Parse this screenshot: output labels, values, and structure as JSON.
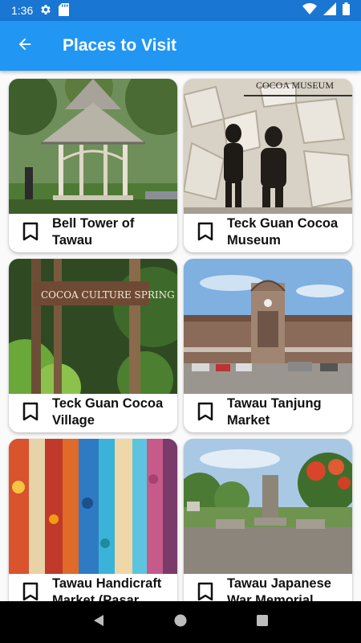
{
  "status_bar": {
    "time": "1:36",
    "icons": [
      "gear-icon",
      "sd-card-icon",
      "wifi-icon",
      "signal-icon",
      "battery-icon"
    ]
  },
  "app_bar": {
    "title": "Places to Visit",
    "back_icon": "arrow-back-icon"
  },
  "places": [
    {
      "title": "Bell Tower of Tawau",
      "bookmark_icon": "bookmark-outline-icon"
    },
    {
      "title": "Teck Guan Cocoa Museum",
      "bookmark_icon": "bookmark-outline-icon",
      "sign_text": "COCOA MUSEUM"
    },
    {
      "title": "Teck Guan Cocoa Village",
      "bookmark_icon": "bookmark-outline-icon",
      "sign_text": "COCOA CULTURE SPRING"
    },
    {
      "title": "Tawau Tanjung Market",
      "bookmark_icon": "bookmark-outline-icon"
    },
    {
      "title": "Tawau Handicraft Market (Pasar",
      "bookmark_icon": "bookmark-outline-icon"
    },
    {
      "title": "Tawau Japanese War Memorial",
      "bookmark_icon": "bookmark-outline-icon"
    }
  ],
  "nav_bar": {
    "icons": [
      "back-triangle-icon",
      "home-circle-icon",
      "recents-square-icon"
    ]
  },
  "colors": {
    "status_bar": "#1976d2",
    "app_bar": "#2196f3",
    "card_bg": "#ffffff",
    "nav_bar": "#000000"
  }
}
